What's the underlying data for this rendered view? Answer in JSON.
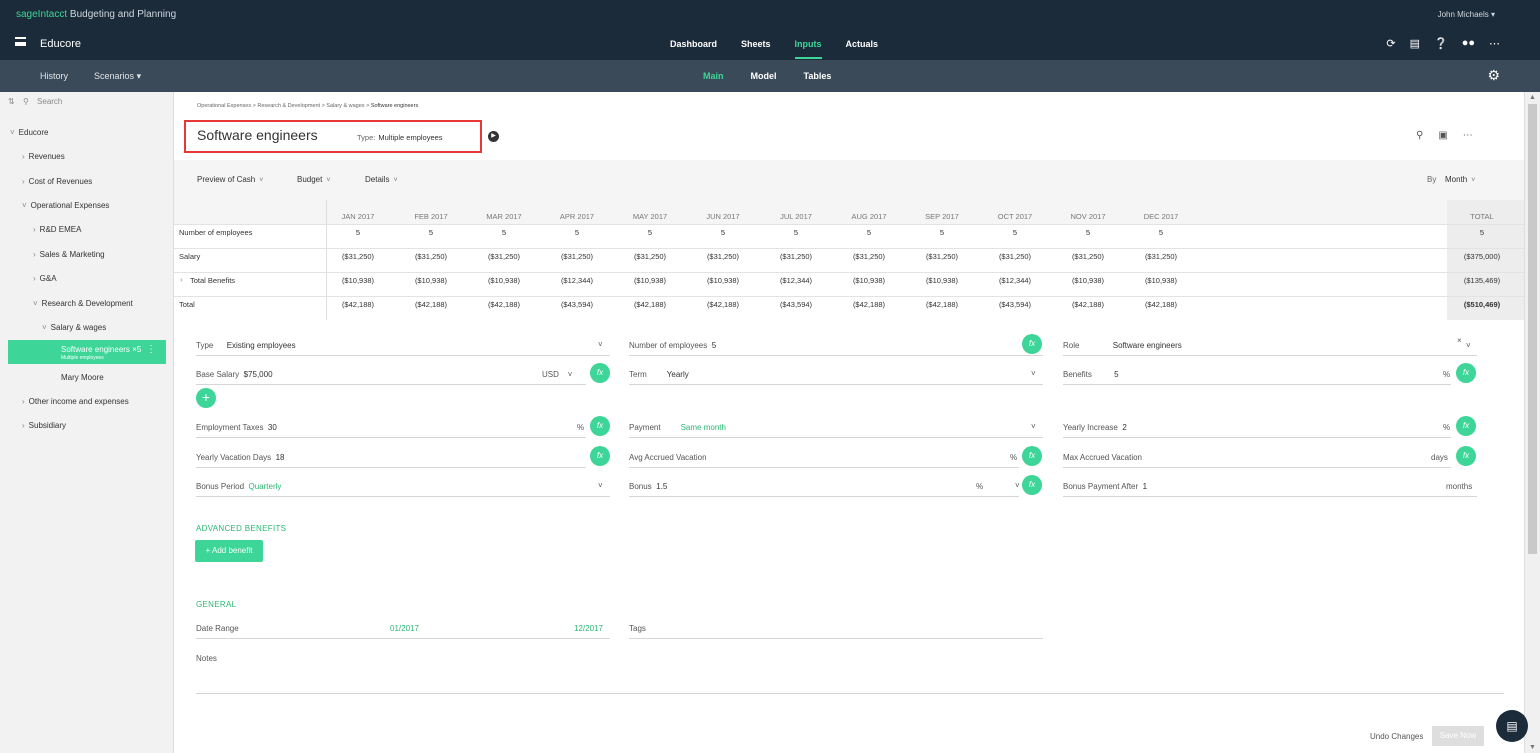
{
  "brand": {
    "name": "sageIntacct",
    "product": " Budgeting and Planning"
  },
  "user": {
    "name": "John Michaels"
  },
  "app": {
    "name": "Educore"
  },
  "main_nav": [
    "Dashboard",
    "Sheets",
    "Inputs",
    "Actuals"
  ],
  "main_nav_active": "Inputs",
  "sub_left": [
    "History",
    "Scenarios"
  ],
  "sub_nav": [
    "Main",
    "Model",
    "Tables"
  ],
  "sub_nav_active": "Main",
  "sidebar": {
    "search_placeholder": "Search",
    "items": [
      {
        "label": "Educore"
      },
      {
        "label": "Revenues"
      },
      {
        "label": "Cost of Revenues"
      },
      {
        "label": "Operational Expenses"
      },
      {
        "label": "R&D EMEA"
      },
      {
        "label": "Sales & Marketing"
      },
      {
        "label": "G&A"
      },
      {
        "label": "Research & Development"
      },
      {
        "label": "Salary & wages"
      },
      {
        "label": "Mary Moore"
      },
      {
        "label": "Other income and expenses"
      },
      {
        "label": "Subsidiary"
      }
    ],
    "active": {
      "label": "Software engineers ×5",
      "sublabel": "Multiple employees"
    }
  },
  "breadcrumb": {
    "path": "Operational Expenses > Research & Development > Salary & wages > ",
    "current": "Software engineers"
  },
  "header": {
    "title": "Software engineers",
    "type_label": "Type:",
    "type_value": "Multiple employees"
  },
  "filters": {
    "preview": "Preview of Cash",
    "budget": "Budget",
    "details": "Details",
    "by_label": "By",
    "by_value": "Month"
  },
  "grid": {
    "months": [
      "JAN 2017",
      "FEB 2017",
      "MAR 2017",
      "APR 2017",
      "MAY 2017",
      "JUN 2017",
      "JUL 2017",
      "AUG 2017",
      "SEP 2017",
      "OCT 2017",
      "NOV 2017",
      "DEC 2017"
    ],
    "total_label": "TOTAL",
    "rows": [
      {
        "label": "Number of employees",
        "values": [
          "5",
          "5",
          "5",
          "5",
          "5",
          "5",
          "5",
          "5",
          "5",
          "5",
          "5",
          "5"
        ],
        "total": "5"
      },
      {
        "label": "Salary",
        "values": [
          "($31,250)",
          "($31,250)",
          "($31,250)",
          "($31,250)",
          "($31,250)",
          "($31,250)",
          "($31,250)",
          "($31,250)",
          "($31,250)",
          "($31,250)",
          "($31,250)",
          "($31,250)"
        ],
        "total": "($375,000)"
      },
      {
        "label": "Total Benefits",
        "values": [
          "($10,938)",
          "($10,938)",
          "($10,938)",
          "($12,344)",
          "($10,938)",
          "($10,938)",
          "($12,344)",
          "($10,938)",
          "($10,938)",
          "($12,344)",
          "($10,938)",
          "($10,938)"
        ],
        "total": "($135,469)"
      },
      {
        "label": "Total",
        "values": [
          "($42,188)",
          "($42,188)",
          "($42,188)",
          "($43,594)",
          "($42,188)",
          "($42,188)",
          "($43,594)",
          "($42,188)",
          "($42,188)",
          "($43,594)",
          "($42,188)",
          "($42,188)"
        ],
        "total": "($510,469)"
      }
    ]
  },
  "form": {
    "type": {
      "label": "Type",
      "value": "Existing employees"
    },
    "num_employees": {
      "label": "Number of employees",
      "value": "5"
    },
    "role": {
      "label": "Role",
      "value": "Software engineers"
    },
    "base_salary": {
      "label": "Base Salary",
      "value": "$75,000",
      "currency": "USD"
    },
    "term": {
      "label": "Term",
      "value": "Yearly"
    },
    "benefits": {
      "label": "Benefits",
      "value": "5",
      "unit": "%"
    },
    "employment_taxes": {
      "label": "Employment Taxes",
      "value": "30",
      "unit": "%"
    },
    "payment": {
      "label": "Payment",
      "value": "Same month"
    },
    "yearly_increase": {
      "label": "Yearly Increase",
      "value": "2",
      "unit": "%"
    },
    "vacation_days": {
      "label": "Yearly Vacation Days",
      "value": "18"
    },
    "avg_accrued": {
      "label": "Avg Accrued Vacation",
      "value": "",
      "unit": "%"
    },
    "max_accrued": {
      "label": "Max Accrued Vacation",
      "value": "",
      "unit": "days"
    },
    "bonus_period": {
      "label": "Bonus Period",
      "value": "Quarterly"
    },
    "bonus": {
      "label": "Bonus",
      "value": "1.5",
      "unit": "%"
    },
    "bonus_after": {
      "label": "Bonus Payment After",
      "value": "1",
      "unit": "months"
    },
    "fx": "fx"
  },
  "advanced": {
    "title": "ADVANCED BENEFITS",
    "add_label": "+ Add benefit"
  },
  "general": {
    "title": "GENERAL",
    "date_range_label": "Date Range",
    "date_from": "01/2017",
    "date_to": "12/2017",
    "tags_label": "Tags",
    "notes_label": "Notes"
  },
  "footer": {
    "undo": "Undo Changes",
    "save": "Save Now"
  },
  "colors": {
    "accent": "#3dd598",
    "topbar": "#1c2b3a",
    "subbar": "#3b4a58",
    "highlight_box": "#e53935"
  }
}
